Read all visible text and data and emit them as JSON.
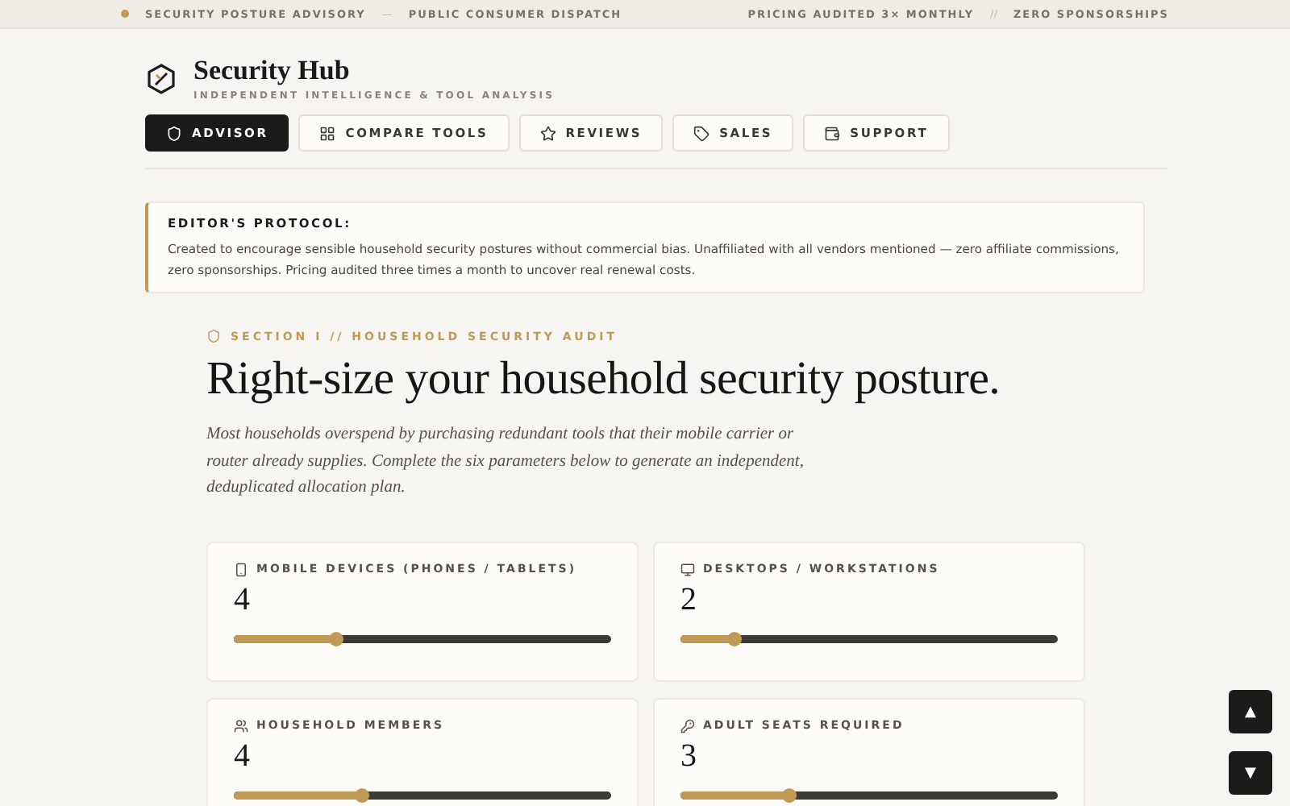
{
  "top_bar": {
    "left": [
      "SECURITY POSTURE ADVISORY",
      "—",
      "PUBLIC CONSUMER DISPATCH"
    ],
    "right": [
      "PRICING AUDITED 3× MONTHLY",
      "//",
      "ZERO SPONSORSHIPS"
    ]
  },
  "brand": {
    "title": "Security Hub",
    "subtitle": "INDEPENDENT INTELLIGENCE & TOOL ANALYSIS"
  },
  "nav": [
    {
      "label": "ADVISOR",
      "selected": true
    },
    {
      "label": "COMPARE TOOLS",
      "selected": false
    },
    {
      "label": "REVIEWS",
      "selected": false
    },
    {
      "label": "SALES",
      "selected": false
    },
    {
      "label": "SUPPORT",
      "selected": false
    }
  ],
  "notice": {
    "title": "EDITOR'S PROTOCOL:",
    "body": "Created to encourage sensible household security postures without commercial bias. Unaffiliated with all vendors mentioned — zero affiliate commissions, zero sponsorships. Pricing audited three times a month to uncover real renewal costs."
  },
  "section": {
    "eyebrow": "SECTION I // HOUSEHOLD SECURITY AUDIT",
    "heading": "Right-size your household security posture.",
    "intro": "Most households overspend by purchasing redundant tools that their mobile carrier or router already supplies. Complete the six parameters below to generate an independent, deduplicated allocation plan."
  },
  "parameters": [
    {
      "label": "MOBILE DEVICES (PHONES / TABLETS)",
      "value": "4",
      "level": 0.27
    },
    {
      "label": "DESKTOPS / WORKSTATIONS",
      "value": "2",
      "level": 0.145
    },
    {
      "label": "HOUSEHOLD MEMBERS",
      "value": "4",
      "level": 0.34
    },
    {
      "label": "ADULT SEATS REQUIRED",
      "value": "3",
      "level": 0.29
    }
  ],
  "scroll_buttons": [
    "▲",
    "▼"
  ]
}
